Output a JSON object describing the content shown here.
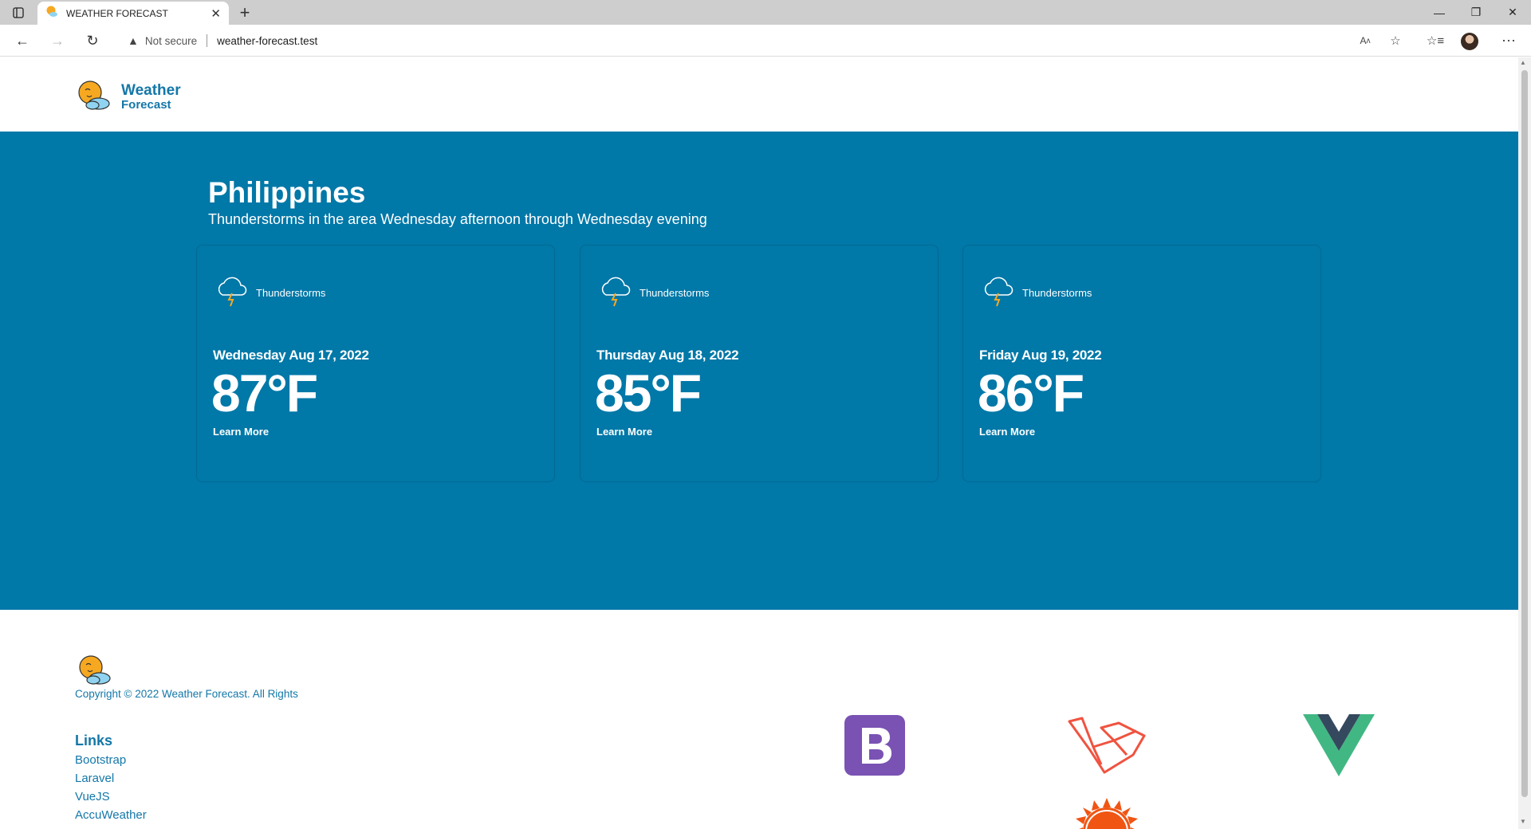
{
  "browser": {
    "tab_title": "WEATHER FORECAST",
    "security_label": "Not secure",
    "url": "weather-forecast.test"
  },
  "header": {
    "logo_line1": "Weather",
    "logo_line2": "Forecast"
  },
  "hero": {
    "location": "Philippines",
    "summary": "Thunderstorms in the area Wednesday afternoon through Wednesday evening",
    "cards": [
      {
        "condition": "Thunderstorms",
        "date": "Wednesday Aug 17, 2022",
        "temperature": "87°F",
        "link": "Learn More"
      },
      {
        "condition": "Thunderstorms",
        "date": "Thursday Aug 18, 2022",
        "temperature": "85°F",
        "link": "Learn More"
      },
      {
        "condition": "Thunderstorms",
        "date": "Friday Aug 19, 2022",
        "temperature": "86°F",
        "link": "Learn More"
      }
    ]
  },
  "footer": {
    "copyright": "Copyright © 2022 Weather Forecast. All Rights",
    "links_title": "Links",
    "links": [
      "Bootstrap",
      "Laravel",
      "VueJS",
      "AccuWeather"
    ]
  },
  "colors": {
    "hero_bg": "#0078a8",
    "brand": "#1477a8",
    "bootstrap": "#7952b3",
    "laravel": "#f05340",
    "vue_green": "#41b883",
    "vue_dark": "#35495e",
    "accuweather": "#f05514"
  },
  "icons": [
    "sun-cloud-logo-icon",
    "thunderstorm-icon",
    "bootstrap-logo-icon",
    "laravel-logo-icon",
    "vuejs-logo-icon",
    "accuweather-logo-icon"
  ]
}
